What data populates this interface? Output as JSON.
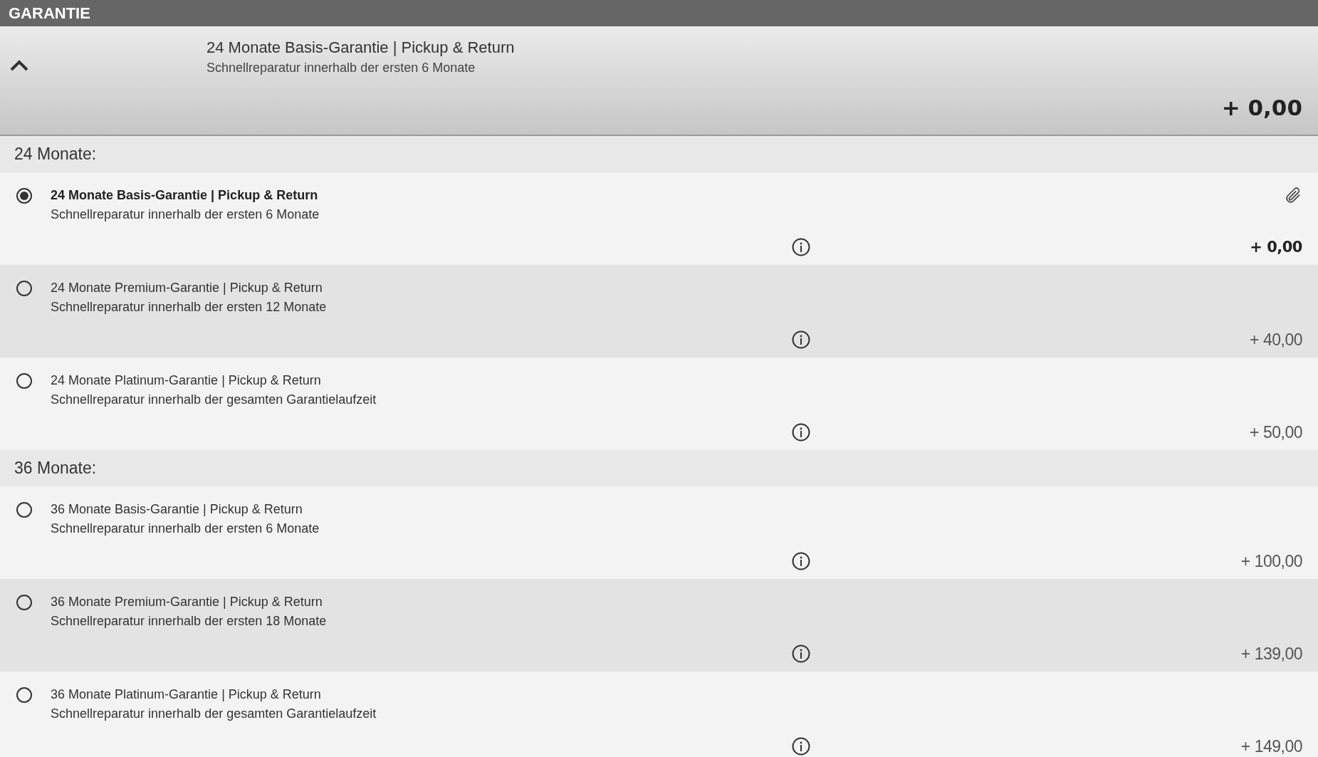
{
  "section_title": "GARANTIE",
  "summary": {
    "expanded": true,
    "title": "24 Monate Basis-Garantie | Pickup & Return",
    "subtitle": "Schnellreparatur innerhalb der ersten 6 Monate",
    "price": "+ 0,00"
  },
  "groups": [
    {
      "label": "24 Monate:",
      "options": [
        {
          "title": "24 Monate Basis-Garantie | Pickup & Return",
          "subtitle": "Schnellreparatur innerhalb der ersten 6 Monate",
          "price": "+ 0,00",
          "selected": true
        },
        {
          "title": "24 Monate Premium-Garantie | Pickup & Return",
          "subtitle": "Schnellreparatur innerhalb der ersten 12 Monate",
          "price": "+ 40,00",
          "selected": false
        },
        {
          "title": "24 Monate Platinum-Garantie | Pickup & Return",
          "subtitle": "Schnellreparatur innerhalb der gesamten Garantielaufzeit",
          "price": "+ 50,00",
          "selected": false
        }
      ]
    },
    {
      "label": "36 Monate:",
      "options": [
        {
          "title": "36 Monate Basis-Garantie | Pickup & Return",
          "subtitle": "Schnellreparatur innerhalb der ersten 6 Monate",
          "price": "+ 100,00",
          "selected": false
        },
        {
          "title": "36 Monate Premium-Garantie | Pickup & Return",
          "subtitle": "Schnellreparatur innerhalb der ersten 18 Monate",
          "price": "+ 139,00",
          "selected": false
        },
        {
          "title": "36 Monate Platinum-Garantie | Pickup & Return",
          "subtitle": "Schnellreparatur innerhalb der gesamten Garantielaufzeit",
          "price": "+ 149,00",
          "selected": false
        }
      ]
    }
  ]
}
